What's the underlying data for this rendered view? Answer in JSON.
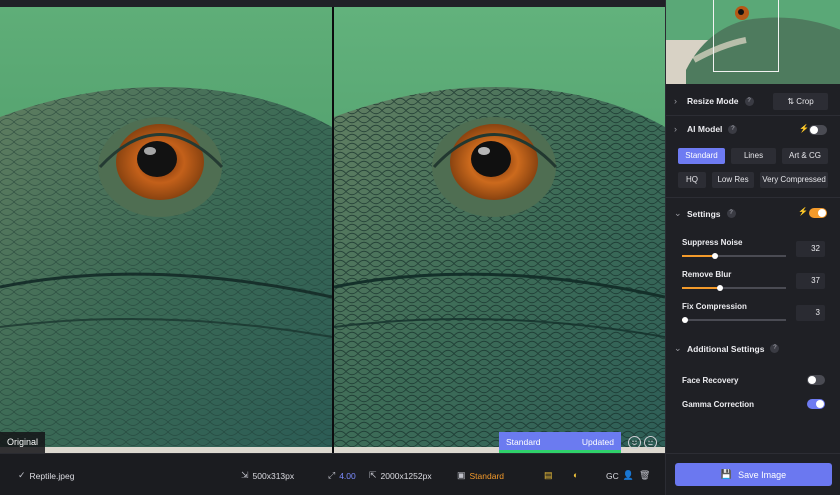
{
  "viewer": {
    "original_label": "Original",
    "model_label": "Standard",
    "status_label": "Updated",
    "progress": 1.0
  },
  "bottombar": {
    "file_name": "Reptile.jpeg",
    "input_size": "500x313px",
    "scale": "4.00",
    "output_size": "2000x1252px",
    "model": "Standard",
    "gc_label": "GC"
  },
  "sidebar": {
    "resize_mode": {
      "label": "Resize Mode",
      "crop_label": "Crop"
    },
    "ai_model": {
      "label": "AI Model",
      "enabled": false,
      "options": [
        "Standard",
        "Lines",
        "Art & CG",
        "HQ",
        "Low Res",
        "Very Compressed"
      ],
      "selected": "Standard"
    },
    "settings": {
      "label": "Settings",
      "enabled": true,
      "suppress_noise": {
        "label": "Suppress Noise",
        "value": "32",
        "level": 0.32
      },
      "remove_blur": {
        "label": "Remove Blur",
        "value": "37",
        "level": 0.37
      },
      "fix_compression": {
        "label": "Fix Compression",
        "value": "3",
        "level": 0.03
      }
    },
    "additional": {
      "label": "Additional Settings",
      "face_recovery": {
        "label": "Face Recovery",
        "enabled": false
      },
      "gamma_correction": {
        "label": "Gamma Correction",
        "enabled": true
      }
    },
    "save_label": "Save Image"
  },
  "colors": {
    "accent": "#6e7bf2",
    "orange": "#f39a2b",
    "panel": "#1f2025"
  },
  "icons": {
    "check": "check-icon",
    "resize": "resize-icon",
    "scale": "expand-icon",
    "output": "output-size-icon",
    "model": "model-icon",
    "save": "save-icon"
  }
}
